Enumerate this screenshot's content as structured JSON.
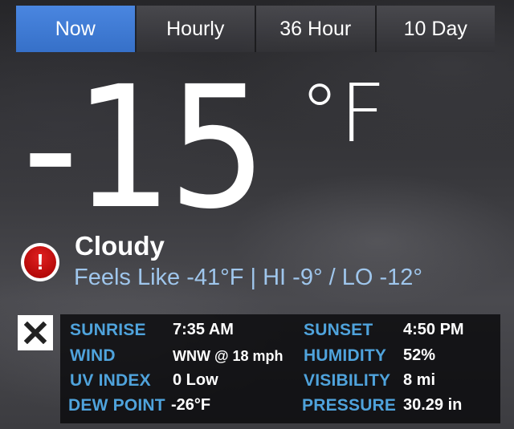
{
  "tabs": [
    {
      "label": "Now",
      "active": true
    },
    {
      "label": "Hourly",
      "active": false
    },
    {
      "label": "36 Hour",
      "active": false
    },
    {
      "label": "10 Day",
      "active": false
    }
  ],
  "current": {
    "temperature": "-15",
    "unit": "°F",
    "condition": "Cloudy",
    "feels_line": "Feels Like -41°F | HI -9° / LO -12°"
  },
  "alert": {
    "icon": "alert-exclamation-icon",
    "symbol": "!",
    "color": "#c40000"
  },
  "close": {
    "icon": "close-x-icon"
  },
  "details": {
    "sunrise": {
      "label": "SUNRISE",
      "value": "7:35 AM"
    },
    "sunset": {
      "label": "SUNSET",
      "value": "4:50 PM"
    },
    "wind": {
      "label": "WIND",
      "value": "WNW @ 18 mph"
    },
    "humidity": {
      "label": "HUMIDITY",
      "value": "52%"
    },
    "uv_index": {
      "label": "UV INDEX",
      "value": "0 Low"
    },
    "visibility": {
      "label": "VISIBILITY",
      "value": "8 mi"
    },
    "dew_point": {
      "label": "DEW POINT",
      "value": "-26°F"
    },
    "pressure": {
      "label": "PRESSURE",
      "value": "30.29 in"
    }
  },
  "colors": {
    "active_tab": "#3f7cd8",
    "label_blue": "#4fa3dc",
    "feels_blue": "#9fc6ec"
  }
}
